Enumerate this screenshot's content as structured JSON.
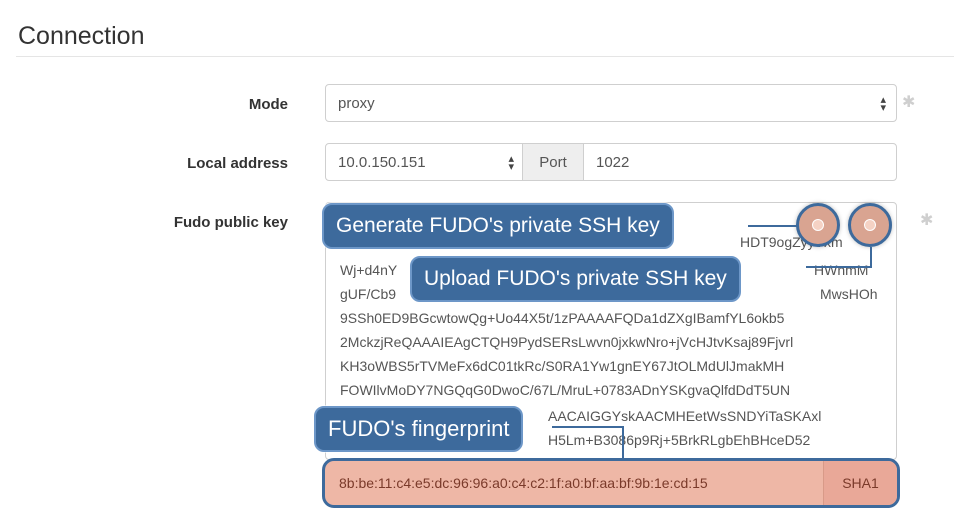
{
  "section": {
    "title": "Connection"
  },
  "mode": {
    "label": "Mode",
    "value": "proxy"
  },
  "local_address": {
    "label": "Local address",
    "value": "10.0.150.151",
    "port_label": "Port",
    "port_value": "1022"
  },
  "public_key": {
    "label": "Fudo public key",
    "lines": [
      "HDT9ogZyyYxm",
      "Wj+d4nY",
      "HWnmM",
      "gUF/Cb9",
      "MwsHOh",
      "9SSh0ED9BGcwtowQg+Uo44X5t/1zPAAAAFQDa1dZXgIBamfYL6okb5",
      "2MckzjReQAAAIEAgCTQH9PydSERsLwvn0jxkwNro+jVcHJtvKsaj89Fjvrl",
      "KH3oWBS5rTVMeFx6dC01tkRc/S0RA1Yw1gnEY67JtOLMdUlJmakMH",
      "FOWIlvMoDY7NGQqG0DwoC/67L/MruL+0783ADnYSKgvaQlfdDdT5UN",
      "AACAIGGYskAACMHEetWsSNDYiTaSKAxl",
      "H5Lm+B3086p9Rj+5BrkRLgbEhBHceD52"
    ]
  },
  "callouts": {
    "generate": "Generate FUDO's private SSH key",
    "upload": "Upload FUDO's private SSH key",
    "fingerprint": "FUDO's fingerprint"
  },
  "fingerprint": {
    "value": "8b:be:11:c4:e5:dc:96:96:a0:c4:c2:1f:a0:bf:aa:bf:9b:1e:cd:15",
    "algo": "SHA1"
  },
  "colors": {
    "callout_bg": "#3d6a9c",
    "highlight": "#eeb7a6"
  }
}
